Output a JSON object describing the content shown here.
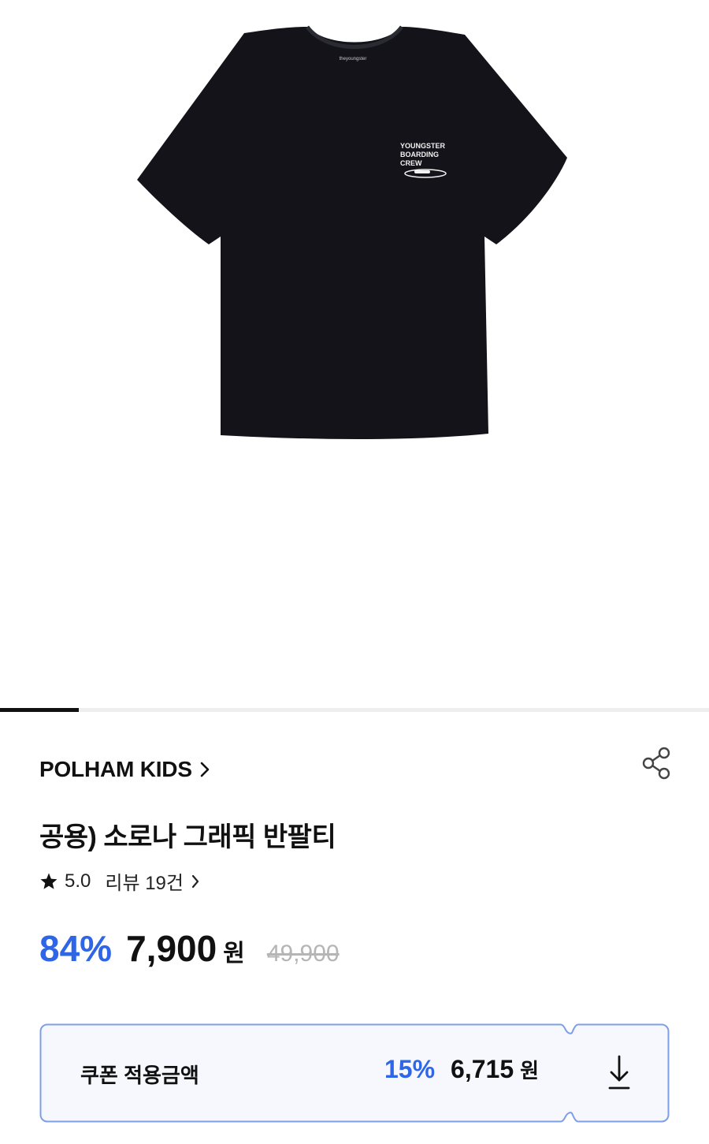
{
  "product_image": {
    "alt": "black short sleeve t-shirt",
    "chest_print": [
      "YOUNGSTER",
      "BOARDING",
      "CREW"
    ],
    "neck_label": "theyoungster"
  },
  "image_pager": {
    "current_fraction": 0.111
  },
  "brand": {
    "name": "POLHAM KIDS",
    "chevron": "chevron-right-icon"
  },
  "share": {
    "icon": "share-icon"
  },
  "product": {
    "title": "공용) 소로나 그래픽 반팔티"
  },
  "rating": {
    "score": "5.0",
    "review_label": "리뷰 19건"
  },
  "price": {
    "discount": "84%",
    "sale": "7,900",
    "currency": "원",
    "original": "49,900"
  },
  "coupon": {
    "label": "쿠폰 적용금액",
    "percent": "15%",
    "amount": "6,715",
    "currency": "원",
    "icon": "download-icon"
  },
  "colors": {
    "accent": "#2f66e8",
    "text": "#111111",
    "muted": "#b5b5b5",
    "coupon_bg": "#f6f8fd",
    "coupon_border": "#7d9fe8"
  }
}
